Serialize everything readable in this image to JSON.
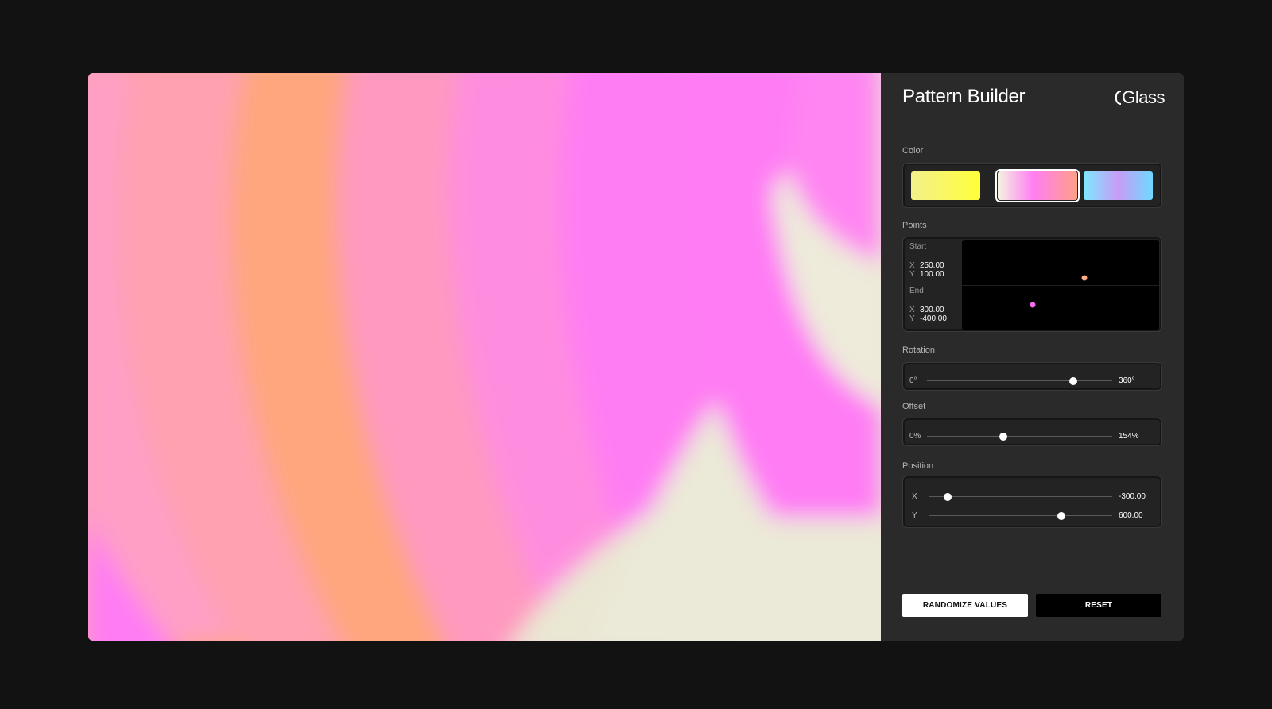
{
  "app": {
    "title": "Pattern Builder",
    "logo_text": "Glass"
  },
  "color": {
    "label": "Color",
    "swatches": [
      {
        "name": "yellow",
        "from": "#f3f08a",
        "to": "#ffff3a",
        "selected": false
      },
      {
        "name": "pink",
        "from": "#f4f4e2",
        "to": "#ff7ef2",
        "end": "#ff9f88",
        "selected": true
      },
      {
        "name": "blue",
        "from": "#7ee8ff",
        "to": "#c79cf5",
        "end": "#70d8ff",
        "selected": false
      }
    ]
  },
  "points": {
    "label": "Points",
    "start_label": "Start",
    "end_label": "End",
    "x_axis": "X",
    "y_axis": "Y",
    "start": {
      "x": "250.00",
      "y": "100.00"
    },
    "end": {
      "x": "300.00",
      "y": "-400.00"
    },
    "start_color": "#ffab86",
    "end_color": "#ff6cf0"
  },
  "rotation": {
    "label": "Rotation",
    "min_label": "0°",
    "max_label": "360°",
    "fraction": 0.79
  },
  "offset": {
    "label": "Offset",
    "min_label": "0%",
    "max_label": "154%",
    "fraction": 0.41
  },
  "position": {
    "label": "Position",
    "x_axis": "X",
    "y_axis": "Y",
    "x_value": "-300.00",
    "y_value": "600.00",
    "x_fraction": 0.1,
    "y_fraction": 0.72
  },
  "actions": {
    "randomize_label": "RANDOMIZE VALUES",
    "reset_label": "RESET"
  }
}
